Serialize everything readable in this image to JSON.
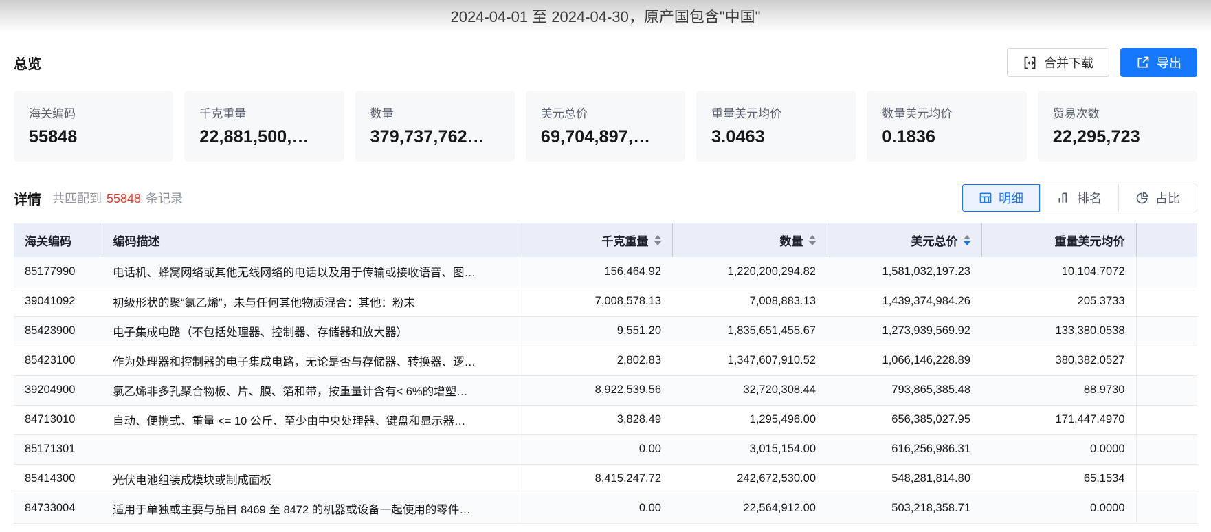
{
  "colors": {
    "accent_blue": "#1677ff",
    "accent_red": "#e8382d",
    "table_header_bg": "#e9eef9",
    "card_bg": "#f7f8fa"
  },
  "topbar": {
    "title": "2024-04-01 至 2024-04-30，原产国包含\"中国\""
  },
  "overview": {
    "title": "总览",
    "merge_download_label": "合并下载",
    "export_label": "导出",
    "cards": [
      {
        "label": "海关编码",
        "value": "55848"
      },
      {
        "label": "千克重量",
        "value": "22,881,500,…"
      },
      {
        "label": "数量",
        "value": "379,737,762…"
      },
      {
        "label": "美元总价",
        "value": "69,704,897,…"
      },
      {
        "label": "重量美元均价",
        "value": "3.0463"
      },
      {
        "label": "数量美元均价",
        "value": "0.1836"
      },
      {
        "label": "贸易次数",
        "value": "22,295,723"
      }
    ]
  },
  "detail": {
    "title": "详情",
    "match_prefix": "共匹配到",
    "match_count": "55848",
    "match_suffix": "条记录",
    "tabs": [
      {
        "label": "明细",
        "icon": "table-icon",
        "active": true
      },
      {
        "label": "排名",
        "icon": "ranking-icon",
        "active": false
      },
      {
        "label": "占比",
        "icon": "pie-icon",
        "active": false
      }
    ]
  },
  "table": {
    "columns": [
      {
        "label": "海关编码",
        "align": "left",
        "sortable": false
      },
      {
        "label": "编码描述",
        "align": "left",
        "sortable": false
      },
      {
        "label": "千克重量",
        "align": "right",
        "sortable": true,
        "sort": null
      },
      {
        "label": "数量",
        "align": "right",
        "sortable": true,
        "sort": null
      },
      {
        "label": "美元总价",
        "align": "right",
        "sortable": true,
        "sort": "desc"
      },
      {
        "label": "重量美元均价",
        "align": "right",
        "sortable": false
      },
      {
        "label": "",
        "align": "left",
        "sortable": false
      }
    ],
    "rows": [
      {
        "code": "85177990",
        "desc": "电话机、蜂窝网络或其他无线网络的电话以及用于传输或接收语音、图…",
        "kg": "156,464.92",
        "qty": "1,220,200,294.82",
        "usd": "1,581,032,197.23",
        "avg": "10,104.7072"
      },
      {
        "code": "39041092",
        "desc": "初级形状的聚“氯乙烯”，未与任何其他物质混合：其他：粉末",
        "kg": "7,008,578.13",
        "qty": "7,008,883.13",
        "usd": "1,439,374,984.26",
        "avg": "205.3733"
      },
      {
        "code": "85423900",
        "desc": "电子集成电路（不包括处理器、控制器、存储器和放大器）",
        "kg": "9,551.20",
        "qty": "1,835,651,455.67",
        "usd": "1,273,939,569.92",
        "avg": "133,380.0538"
      },
      {
        "code": "85423100",
        "desc": "作为处理器和控制器的电子集成电路，无论是否与存储器、转换器、逻…",
        "kg": "2,802.83",
        "qty": "1,347,607,910.52",
        "usd": "1,066,146,228.89",
        "avg": "380,382.0527"
      },
      {
        "code": "39204900",
        "desc": "氯乙烯非多孔聚合物板、片、膜、箔和带，按重量计含有< 6%的增塑…",
        "kg": "8,922,539.56",
        "qty": "32,720,308.44",
        "usd": "793,865,385.48",
        "avg": "88.9730"
      },
      {
        "code": "84713010",
        "desc": "自动、便携式、重量 <= 10 公斤、至少由中央处理器、键盘和显示器…",
        "kg": "3,828.49",
        "qty": "1,295,496.00",
        "usd": "656,385,027.95",
        "avg": "171,447.4970"
      },
      {
        "code": "85171301",
        "desc": "",
        "kg": "0.00",
        "qty": "3,015,154.00",
        "usd": "616,256,986.31",
        "avg": "0.0000"
      },
      {
        "code": "85414300",
        "desc": "光伏电池组装成模块或制成面板",
        "kg": "8,415,247.72",
        "qty": "242,672,530.00",
        "usd": "548,281,814.80",
        "avg": "65.1534"
      },
      {
        "code": "84733004",
        "desc": "适用于单独或主要与品目 8469 至 8472 的机器或设备一起使用的零件…",
        "kg": "0.00",
        "qty": "22,564,912.00",
        "usd": "503,218,358.71",
        "avg": "0.0000"
      }
    ]
  }
}
